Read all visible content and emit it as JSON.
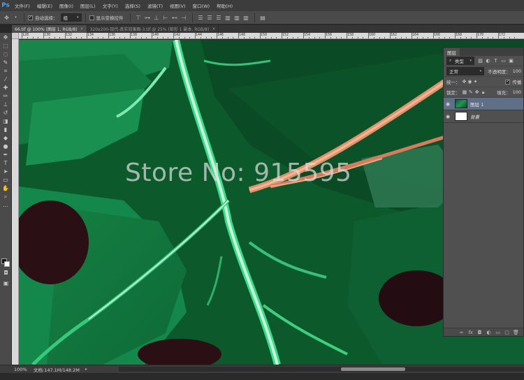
{
  "app": {
    "logo": "Ps"
  },
  "menu": [
    "文件(F)",
    "编辑(E)",
    "图像(I)",
    "图层(L)",
    "文字(Y)",
    "选择(S)",
    "滤镜(T)",
    "视图(V)",
    "窗口(W)",
    "帮助(H)"
  ],
  "options": {
    "auto_select_label": "自动选择：",
    "auto_select_value": "组",
    "show_transform_label": "显示变换控件",
    "auto_select_checked": true,
    "show_transform_checked": false
  },
  "tabs": [
    {
      "label": "66.tif @ 100% (图层 1, RGB/8)",
      "close": "×",
      "active": true
    },
    {
      "label": "320x200-现代-真实效果图-3.tif @ 25% (矩形 1 副本, RGB/8)",
      "close": "×",
      "active": false
    }
  ],
  "ruler": {
    "labels": [
      "128",
      "130",
      "132",
      "134",
      "136",
      "138",
      "140",
      "142",
      "144",
      "146",
      "148",
      "150",
      "152",
      "154",
      "156",
      "158",
      "160",
      "162",
      "164",
      "166",
      "168",
      "170",
      "172"
    ]
  },
  "canvas": {
    "watermark": "Store No: 915595"
  },
  "layers": {
    "tab": "图层",
    "filter_kind": "类型",
    "blend_mode": "正常",
    "opacity_label": "不透明度：",
    "opacity_value": "100",
    "lock_row_label": "锁定：",
    "fill_label": "填充：",
    "fill_value": "100",
    "unify_label": "统一：",
    "propagate_label": "传播",
    "items": [
      {
        "name": "图层 1",
        "selected": true,
        "visible": true
      },
      {
        "name": "背景",
        "selected": false,
        "visible": true
      }
    ]
  },
  "status": {
    "zoom": "100%",
    "doc": "文档:147.1M/148.2M",
    "arrow": "▸"
  },
  "colors": {
    "leaf_dark": "#0a4f26",
    "leaf_mid": "#138a45",
    "leaf_light": "#3ddc8a",
    "vein": "#c9f5dc",
    "stem_orange": "#e2916b",
    "hole": "#2a0f14"
  }
}
